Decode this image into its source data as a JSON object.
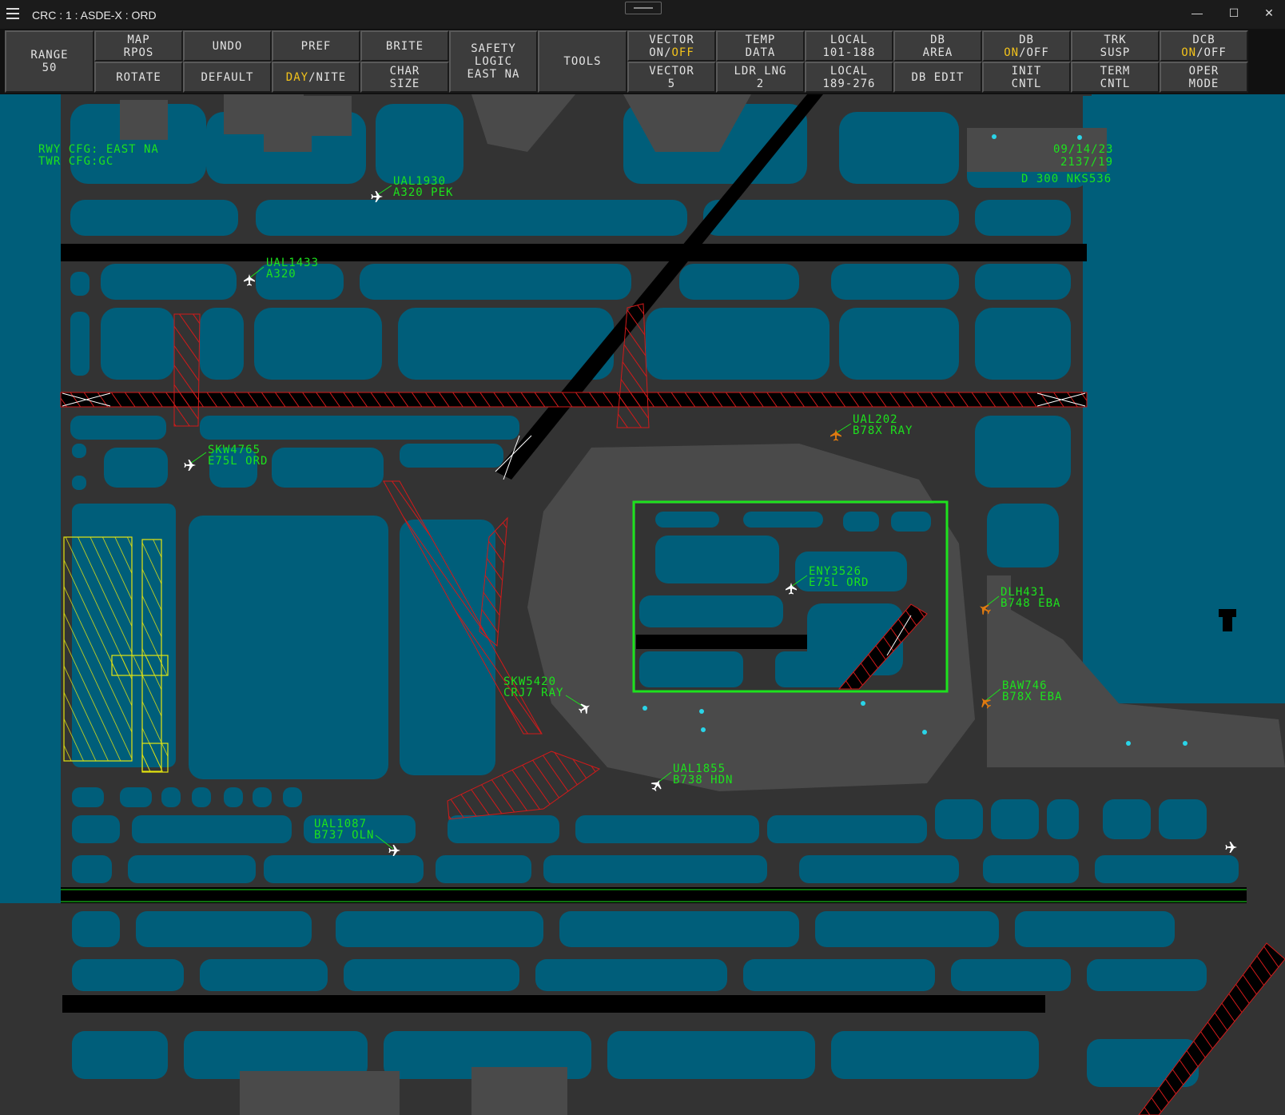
{
  "window": {
    "title": "CRC : 1 : ASDE-X : ORD",
    "menu_icon": "hamburger-icon",
    "controls": [
      "minimize-icon",
      "maximize-icon",
      "close-icon"
    ]
  },
  "dcb": {
    "range": {
      "line1": "RANGE",
      "line2": "50"
    },
    "map_rpos": {
      "line1": "MAP",
      "line2": "RPOS"
    },
    "rotate": "ROTATE",
    "undo": "UNDO",
    "default": "DEFAULT",
    "pref": "PREF",
    "day_nite": {
      "on": "DAY",
      "sep": "/",
      "off": "NITE"
    },
    "brite": "BRITE",
    "char_size": {
      "line1": "CHAR",
      "line2": "SIZE"
    },
    "safety_logic": {
      "line1": "SAFETY",
      "line2": "LOGIC",
      "line3": "EAST NA"
    },
    "tools": "TOOLS",
    "vector_onoff": {
      "line1": "VECTOR",
      "a": "ON",
      "sep": "/",
      "b": "OFF"
    },
    "vector_5": {
      "line1": "VECTOR",
      "line2": "5"
    },
    "temp_data": {
      "line1": "TEMP",
      "line2": "DATA"
    },
    "ldr_lng": {
      "line1": "LDR LNG",
      "line2": "2"
    },
    "local_101": {
      "line1": "LOCAL",
      "line2": "101-188"
    },
    "local_189": {
      "line1": "LOCAL",
      "line2": "189-276"
    },
    "db_area": {
      "line1": "DB",
      "line2": "AREA"
    },
    "db_edit": "DB EDIT",
    "db_onoff": {
      "line1": "DB",
      "a": "ON",
      "sep": "/",
      "b": "OFF"
    },
    "init_cntl": {
      "line1": "INIT",
      "line2": "CNTL"
    },
    "trk_susp": {
      "line1": "TRK",
      "line2": "SUSP"
    },
    "term_cntl": {
      "line1": "TERM",
      "line2": "CNTL"
    },
    "dcb_onoff": {
      "line1": "DCB",
      "a": "ON",
      "sep": "/",
      "b": "OFF"
    },
    "oper_mode": {
      "line1": "OPER",
      "line2": "MODE"
    }
  },
  "map": {
    "rwy_cfg": "RWY CFG: EAST NA",
    "twr_cfg": "TWR CFG:GC",
    "date": "09/14/23",
    "time": "2137/19",
    "d300": "D 300 NKS536",
    "aircraft": [
      {
        "callsign": "UAL1930",
        "info": "A320 PEK",
        "color": "green",
        "icon": "white"
      },
      {
        "callsign": "UAL1433",
        "info": "A320",
        "color": "green",
        "icon": "white"
      },
      {
        "callsign": "SKW4765",
        "info": "E75L ORD",
        "color": "green",
        "icon": "white"
      },
      {
        "callsign": "UAL202",
        "info": "B78X RAY",
        "color": "orange",
        "icon": "orange"
      },
      {
        "callsign": "ENY3526",
        "info": "E75L ORD",
        "color": "green",
        "icon": "white"
      },
      {
        "callsign": "DLH431",
        "info": "B748 EBA",
        "color": "green",
        "icon": "orange"
      },
      {
        "callsign": "SKW5420",
        "info": "CRJ7 RAY",
        "color": "green",
        "icon": "white"
      },
      {
        "callsign": "BAW746",
        "info": "B78X EBA",
        "color": "green",
        "icon": "orange"
      },
      {
        "callsign": "UAL1855",
        "info": "B738 HDN",
        "color": "green",
        "icon": "white"
      },
      {
        "callsign": "UAL1087",
        "info": "B737 OLN",
        "color": "green",
        "icon": "white"
      }
    ],
    "colors": {
      "water": "#005e7a",
      "taxiway": "#333333",
      "runway": "#000000",
      "terminal": "#4a4a4a",
      "text": "#1de21d",
      "alert": "#e07a10",
      "hatch_red": "#d21a1a",
      "hatch_yellow": "#e6e60f"
    }
  }
}
